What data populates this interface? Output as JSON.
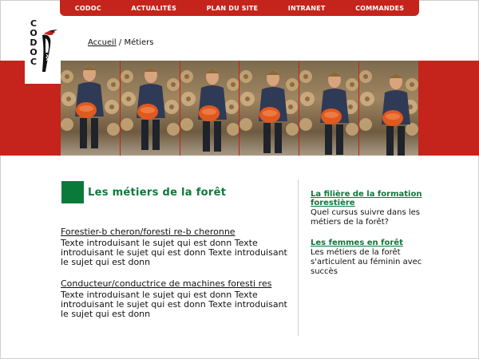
{
  "nav": {
    "items": [
      "CODOC",
      "ACTUALITÉS",
      "PLAN DU SITE",
      "INTRANET",
      "COMMANDES"
    ]
  },
  "logo": {
    "text": "CODOC",
    "icon": "woodpecker-icon"
  },
  "breadcrumb": {
    "home": "Accueil",
    "separator": "/",
    "current": "Métiers"
  },
  "banner": {
    "photo_count": 6
  },
  "main": {
    "title": "Les métiers de la forêt",
    "articles": [
      {
        "title": "Forestier-b cheron/foresti re-b cheronne",
        "body": "Texte introduisant le sujet qui est donn  Texte introduisant le sujet qui est donn  Texte introduisant le sujet qui est donn"
      },
      {
        "title": "Conducteur/conductrice de machines foresti res",
        "body": "Texte introduisant le sujet qui est donn  Texte introduisant le sujet qui est donn  Texte introduisant le sujet qui est donn"
      }
    ]
  },
  "sidebar": {
    "items": [
      {
        "link": "La filière de la formation forestière",
        "desc": "Quel cursus suivre dans les métiers de la forêt?"
      },
      {
        "link": "Les femmes en forêt",
        "desc": "Les métiers de la forêt s'articulent au féminin avec succès"
      }
    ]
  },
  "colors": {
    "brand_red": "#c4241b",
    "brand_green": "#0a7a3a"
  }
}
